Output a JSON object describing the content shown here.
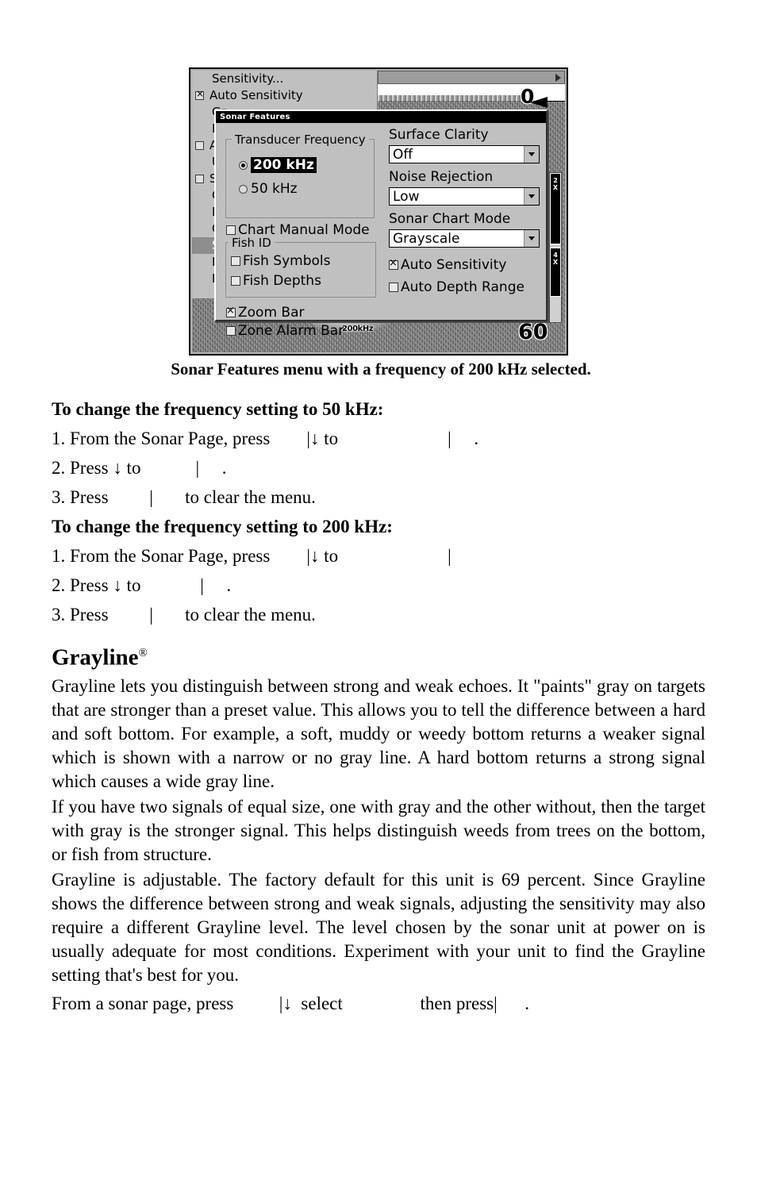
{
  "figure": {
    "caption": "Sonar Features menu with a frequency of 200 kHz selected.",
    "sonar_display": {
      "depth_top_label": "0",
      "depth_bottom_label": "60",
      "frequency_overlay": "200kHz",
      "zoom_bars": [
        {
          "label_line1": "2",
          "label_line2": "X"
        },
        {
          "label_line1": "4",
          "label_line2": "X"
        }
      ]
    },
    "background_menu": {
      "items": [
        {
          "label": "Sensitivity...",
          "checkbox": false,
          "checked": false,
          "selected": false,
          "indent": true
        },
        {
          "label": "Auto Sensitivity",
          "checkbox": true,
          "checked": true,
          "selected": false,
          "indent": false
        },
        {
          "label": "Gr",
          "checkbox": false,
          "checked": false,
          "selected": false,
          "indent": true
        },
        {
          "label": "De",
          "checkbox": false,
          "checked": false,
          "selected": false,
          "indent": true
        },
        {
          "label": "Au",
          "checkbox": true,
          "checked": false,
          "selected": false,
          "indent": false
        },
        {
          "label": "Up",
          "checkbox": false,
          "checked": false,
          "selected": false,
          "indent": true
        },
        {
          "label": "St",
          "checkbox": true,
          "checked": false,
          "selected": false,
          "indent": false
        },
        {
          "label": "Ch",
          "checkbox": false,
          "checked": false,
          "selected": false,
          "indent": true
        },
        {
          "label": "De",
          "checkbox": false,
          "checked": false,
          "selected": false,
          "indent": true
        },
        {
          "label": "Ot",
          "checkbox": false,
          "checked": false,
          "selected": false,
          "indent": true
        },
        {
          "label": "So",
          "checkbox": false,
          "checked": false,
          "selected": true,
          "indent": true
        },
        {
          "label": "Pi",
          "checkbox": false,
          "checked": false,
          "selected": false,
          "indent": true
        },
        {
          "label": "Lo",
          "checkbox": false,
          "checked": false,
          "selected": false,
          "indent": true
        }
      ]
    },
    "dialog": {
      "title": "Sonar Features",
      "transducer_frequency": {
        "legend": "Transducer Frequency",
        "options": [
          {
            "label": "200 kHz",
            "selected": true
          },
          {
            "label": "50 kHz",
            "selected": false
          }
        ]
      },
      "chart_manual_mode": {
        "label": "Chart Manual Mode",
        "checked": false
      },
      "fish_id": {
        "legend": "Fish ID",
        "options": [
          {
            "label": "Fish Symbols",
            "checked": false
          },
          {
            "label": "Fish Depths",
            "checked": false
          }
        ]
      },
      "zoom_bar": {
        "label": "Zoom Bar",
        "checked": true
      },
      "zone_alarm_bar": {
        "label": "Zone Alarm Bar",
        "checked": false
      },
      "surface_clarity": {
        "label": "Surface Clarity",
        "value": "Off"
      },
      "noise_rejection": {
        "label": "Noise Rejection",
        "value": "Low"
      },
      "sonar_chart_mode": {
        "label": "Sonar Chart Mode",
        "value": "Grayscale"
      },
      "auto_sensitivity": {
        "label": "Auto Sensitivity",
        "checked": true
      },
      "auto_depth_range": {
        "label": "Auto Depth Range",
        "checked": false
      }
    }
  },
  "content": {
    "subhead_50": "To change the frequency setting to 50 kHz:",
    "steps_50": [
      "1. From the Sonar Page, press        |↓ to                        |     .",
      "2. Press ↓ to            |     .",
      "3. Press         |       to clear the menu."
    ],
    "subhead_200": "To change the frequency setting to 200 kHz:",
    "steps_200": [
      "1. From the Sonar Page, press        |↓ to                        |",
      "2. Press ↓ to             |     .",
      "3. Press         |       to clear the menu."
    ],
    "section_title": "Grayline",
    "section_title_sup": "®",
    "paragraphs": [
      "Grayline lets you distinguish between strong and weak echoes. It \"paints\" gray on targets that are stronger than a preset value. This allows you to tell the difference between a hard and soft bottom. For example, a soft, muddy or weedy bottom returns a weaker signal which is shown with a narrow or no gray line. A hard bottom returns a strong signal which causes a wide gray line.",
      "If you have two signals of equal size, one with gray and the other without, then the target with gray is the stronger signal. This helps distinguish weeds from trees on the bottom, or fish from structure.",
      "Grayline is adjustable. The factory default for this unit is 69 percent. Since Grayline shows the difference between strong and weak signals, adjusting the sensitivity may also require a different Grayline level. The level chosen by the sonar unit at power on is usually adequate for most conditions. Experiment with your unit to find the Grayline setting that's best for you."
    ],
    "closing_line": "From a sonar page, press          |↓  select                 then press|      ."
  }
}
